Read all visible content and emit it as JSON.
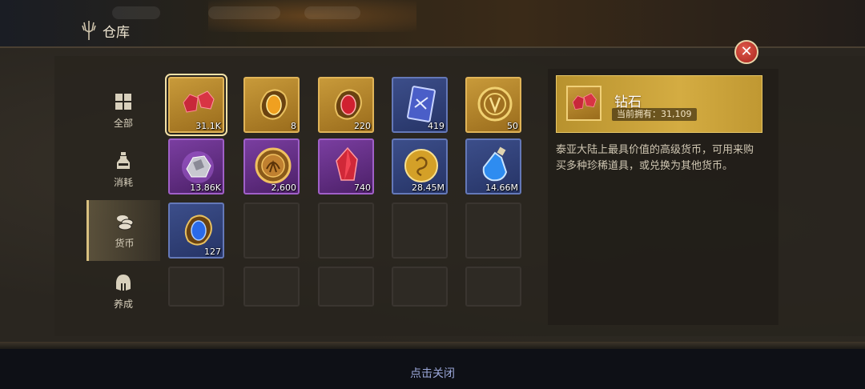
{
  "window": {
    "title": "仓库"
  },
  "sidebar": {
    "items": [
      {
        "label": "全部",
        "icon": "grid-icon",
        "active": false
      },
      {
        "label": "消耗",
        "icon": "potion-icon",
        "active": false
      },
      {
        "label": "货币",
        "icon": "coins-icon",
        "active": true
      },
      {
        "label": "养成",
        "icon": "helmet-icon",
        "active": false
      }
    ]
  },
  "grid": {
    "items": [
      {
        "name": "钻石",
        "qty": "31.1K",
        "rarity": "gold",
        "icon": "red-gem-icon",
        "selected": true
      },
      {
        "qty": "8",
        "rarity": "gold",
        "icon": "amber-emblem-icon"
      },
      {
        "qty": "220",
        "rarity": "gold",
        "icon": "ruby-emblem-icon"
      },
      {
        "qty": "419",
        "rarity": "blue",
        "icon": "scroll-card-icon"
      },
      {
        "qty": "50",
        "rarity": "gold",
        "icon": "gold-coin-icon"
      },
      {
        "qty": "13.86K",
        "rarity": "purple",
        "icon": "silver-ore-icon"
      },
      {
        "qty": "2,600",
        "rarity": "purple",
        "icon": "bronze-medal-icon"
      },
      {
        "qty": "740",
        "rarity": "purple",
        "icon": "red-crystal-icon"
      },
      {
        "qty": "28.45M",
        "rarity": "blue",
        "icon": "gold-coin-icon"
      },
      {
        "qty": "14.66M",
        "rarity": "blue",
        "icon": "blue-potion-icon"
      },
      {
        "qty": "127",
        "rarity": "blue",
        "icon": "sapphire-emblem-icon"
      }
    ]
  },
  "detail": {
    "name": "钻石",
    "owned": "当前拥有：31,109",
    "description": "泰亚大陆上最具价值的高级货币，可用来购买多种珍稀道具，或兑换为其他货币。"
  },
  "footer": {
    "close_hint": "点击关闭"
  },
  "colors": {
    "gold": "#c89a3a",
    "blue": "#3c4e8a",
    "purple": "#7a3ea0",
    "accent": "#d8c080"
  }
}
